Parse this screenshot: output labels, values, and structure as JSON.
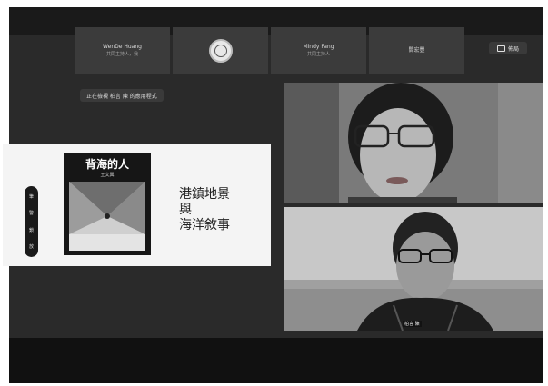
{
  "participants": [
    {
      "name": "WenDe Huang",
      "role": "共同主持人，我"
    },
    {
      "name": "",
      "role": ""
    },
    {
      "name": "Mindy Fang",
      "role": "共同主持人"
    },
    {
      "name": "間宏豐",
      "role": ""
    }
  ],
  "layout_button": "佈局",
  "viewing_banner": "正在檢視 柏言 陳 的應用程式",
  "slide": {
    "book_title": "背海的人",
    "book_author": "王文興",
    "line1": "港鎮地景",
    "line2": "與",
    "line3": "海洋敘事"
  },
  "annotation_tools": [
    "筆",
    "警",
    "鎖",
    "放"
  ],
  "video_speaker_name": "柏言 陳"
}
